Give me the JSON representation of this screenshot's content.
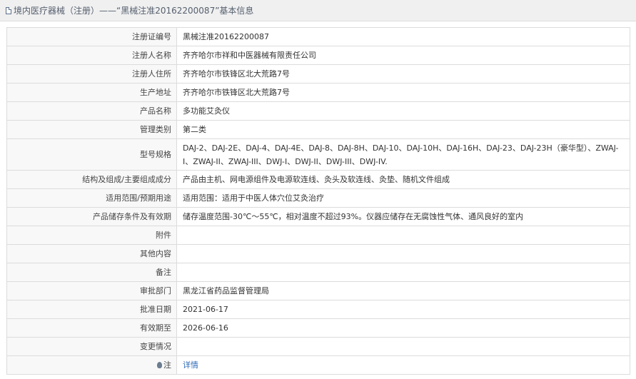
{
  "header": {
    "title": "境内医疗器械（注册）——“黑械注准20162200087”基本信息",
    "icon": "document-icon"
  },
  "rows": [
    {
      "label": "注册证编号",
      "value": "黑械注准20162200087"
    },
    {
      "label": "注册人名称",
      "value": "齐齐哈尔市祥和中医器械有限责任公司"
    },
    {
      "label": "注册人住所",
      "value": "齐齐哈尔市铁锋区北大荒路7号"
    },
    {
      "label": "生产地址",
      "value": "齐齐哈尔市铁锋区北大荒路7号"
    },
    {
      "label": "产品名称",
      "value": "多功能艾灸仪"
    },
    {
      "label": "管理类别",
      "value": "第二类"
    },
    {
      "label": "型号规格",
      "value": "DAJ-2、DAJ-2E、DAJ-4、DAJ-4E、DAJ-8、DAJ-8H、DAJ-10、DAJ-10H、DAJ-16H、DAJ-23、DAJ-23H（豪华型）、ZWAJ-I、ZWAJ-II、ZWAJ-III、DWJ-I、DWJ-II、DWJ-III、DWJ-IV."
    },
    {
      "label": "结构及组成/主要组成成分",
      "value": "产品由主机、网电源组件及电源软连线、灸头及软连线、灸垫、随机文件组成"
    },
    {
      "label": "适用范围/预期用途",
      "value": "适用范围：适用于中医人体穴位艾灸治疗"
    },
    {
      "label": "产品储存条件及有效期",
      "value": "储存温度范围-30℃～55℃，相对温度不超过93%。仪器应储存在无腐蚀性气体、通风良好的室内"
    },
    {
      "label": "附件",
      "value": ""
    },
    {
      "label": "其他内容",
      "value": ""
    },
    {
      "label": "备注",
      "value": ""
    },
    {
      "label": "审批部门",
      "value": "黑龙江省药品监督管理局"
    },
    {
      "label": "批准日期",
      "value": "2021-06-17"
    },
    {
      "label": "有效期至",
      "value": "2026-06-16"
    },
    {
      "label": "变更情况",
      "value": ""
    },
    {
      "label": "注",
      "value": "详情",
      "icon": "lightbulb-icon"
    }
  ],
  "colors": {
    "link": "#2f6cb8",
    "header_bg": "#f0f0f0",
    "label_bg": "#f8f8f8",
    "border": "#dcdcdc"
  }
}
